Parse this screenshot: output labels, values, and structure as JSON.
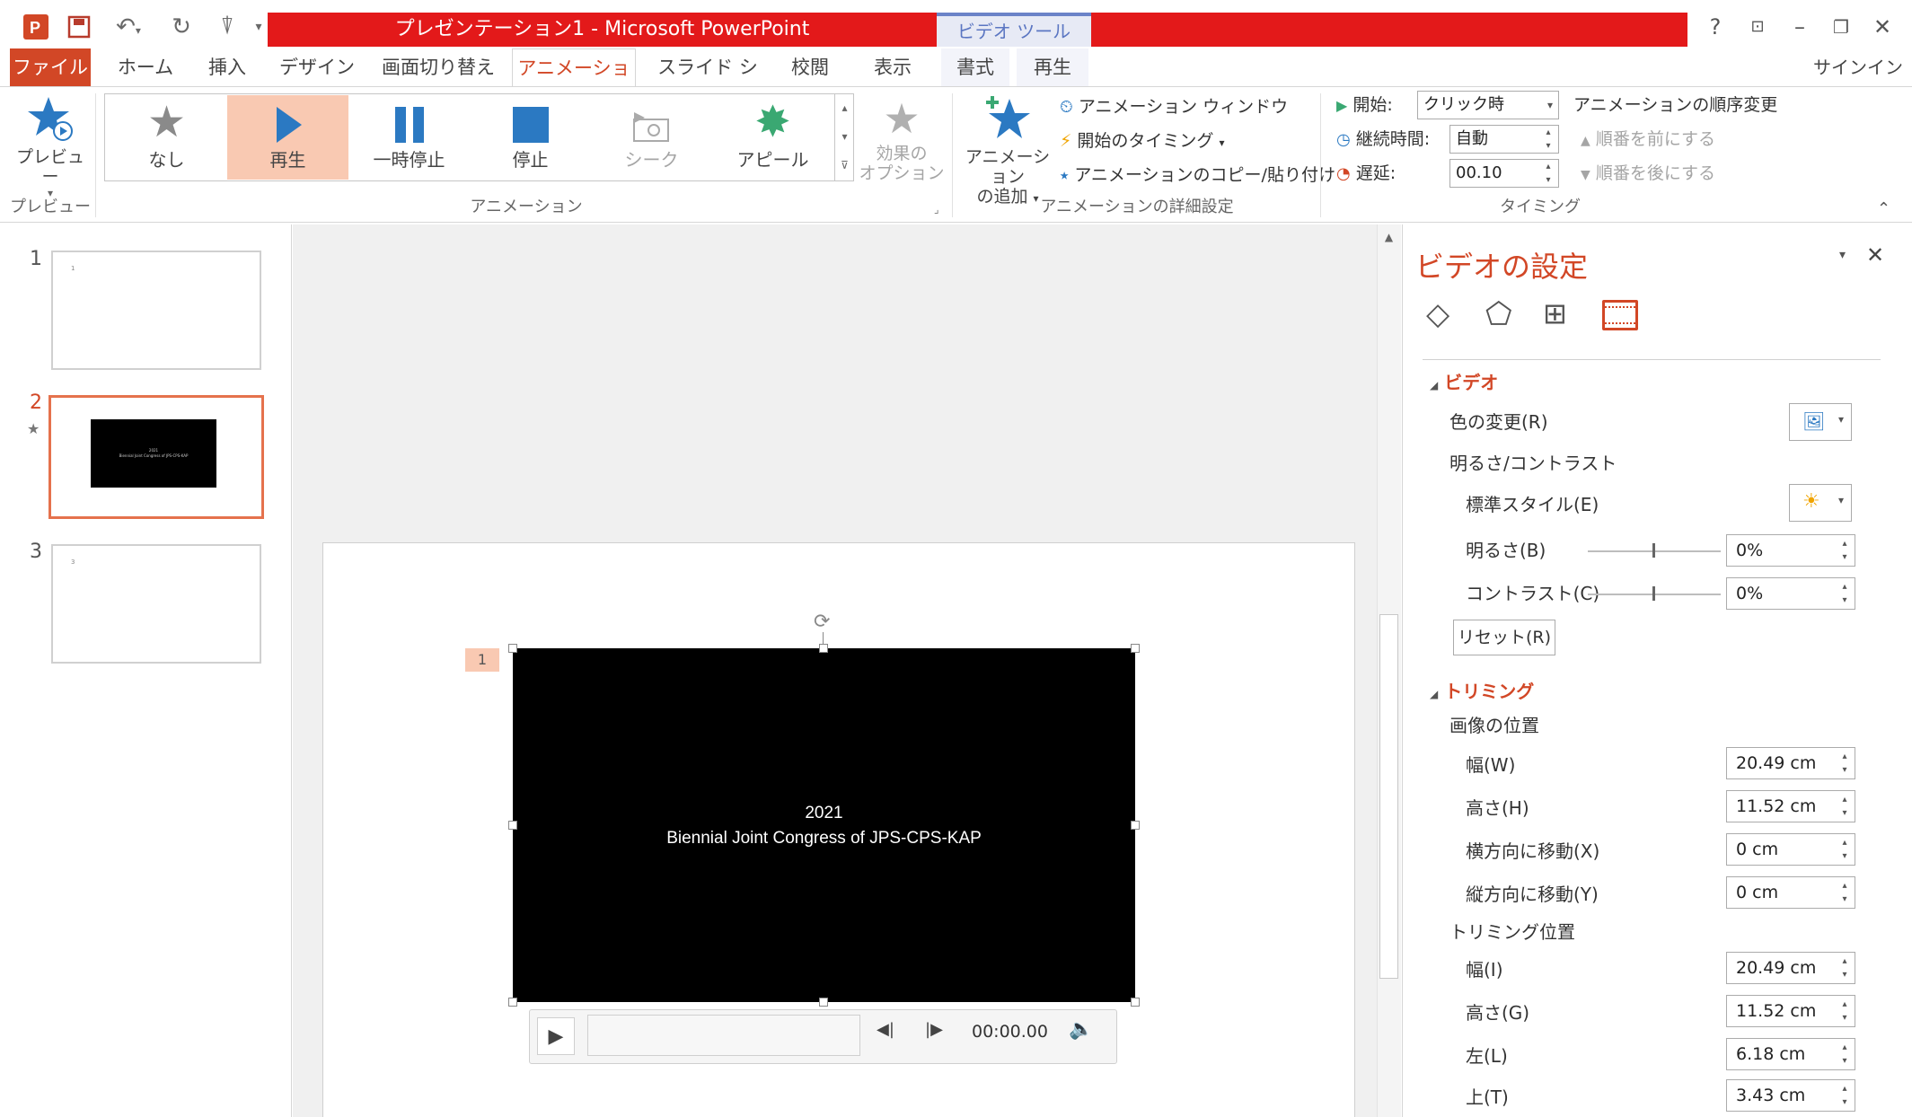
{
  "window": {
    "title": "プレゼンテーション1 - Microsoft PowerPoint",
    "context_tab": "ビデオ ツール",
    "help": "?",
    "signin": "サインイン"
  },
  "tabs": [
    "ファイル",
    "ホーム",
    "挿入",
    "デザイン",
    "画面切り替え",
    "アニメーション",
    "スライド ショー",
    "校閲",
    "表示",
    "書式",
    "再生"
  ],
  "ribbon": {
    "preview_button": "プレビュー",
    "preview_group": "プレビュー",
    "animation_group": "アニメーション",
    "gallery": [
      "なし",
      "再生",
      "一時停止",
      "停止",
      "シーク",
      "アピール"
    ],
    "effect_options_line1": "効果の",
    "effect_options_line2": "オプション",
    "add_animation_line1": "アニメーション",
    "add_animation_line2": "の追加",
    "animation_pane": "アニメーション ウィンドウ",
    "trigger": "開始のタイミング",
    "animation_painter": "アニメーションのコピー/貼り付け",
    "advanced_group": "アニメーションの詳細設定",
    "start_label": "開始:",
    "start_value": "クリック時",
    "duration_label": "継続時間:",
    "duration_value": "自動",
    "delay_label": "遅延:",
    "delay_value": "00.10",
    "reorder_title": "アニメーションの順序変更",
    "move_earlier": "順番を前にする",
    "move_later": "順番を後にする",
    "timing_group": "タイミング"
  },
  "slides": {
    "numbers": [
      "1",
      "2",
      "3"
    ],
    "thumb1_tiny": "1",
    "thumb3_tiny": "3",
    "thumb2_line1": "2021",
    "thumb2_line2": "Biennial Joint Congress of JPS-CPS-KAP",
    "selected_index": 2
  },
  "slide": {
    "anim_tag": "1",
    "video_line1": "2021",
    "video_line2": "Biennial Joint Congress of JPS-CPS-KAP",
    "player_time": "00:00.00"
  },
  "pane": {
    "title": "ビデオの設定",
    "video_section": "ビデオ",
    "recolor": "色の変更(R)",
    "brightness_contrast": "明るさ/コントラスト",
    "presets": "標準スタイル(E)",
    "brightness": "明るさ(B)",
    "brightness_value": "0%",
    "contrast": "コントラスト(C)",
    "contrast_value": "0%",
    "reset": "リセット(R)",
    "crop_section": "トリミング",
    "picture_position": "画像の位置",
    "width_w": "幅(W)",
    "width_w_value": "20.49 cm",
    "height_h": "高さ(H)",
    "height_h_value": "11.52 cm",
    "offset_x": "横方向に移動(X)",
    "offset_x_value": "0 cm",
    "offset_y": "縦方向に移動(Y)",
    "offset_y_value": "0 cm",
    "crop_position": "トリミング位置",
    "width_i": "幅(I)",
    "width_i_value": "20.49 cm",
    "height_g": "高さ(G)",
    "height_g_value": "11.52 cm",
    "left_l": "左(L)",
    "left_l_value": "6.18 cm",
    "top_t": "上(T)",
    "top_t_value": "3.43 cm"
  },
  "colors": {
    "accent": "#d24726",
    "title_bar": "#e3191a",
    "selected_gallery": "#f9c9b2",
    "icon_blue": "#2b79c2",
    "icon_green": "#3aa872"
  }
}
